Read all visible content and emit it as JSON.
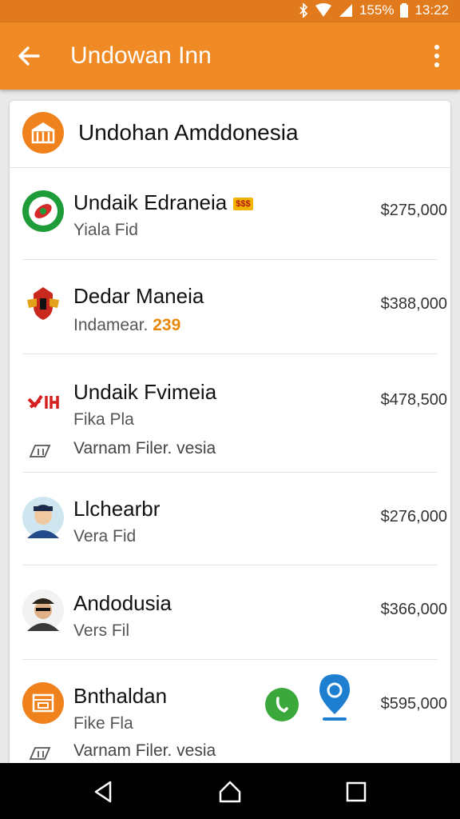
{
  "status_bar": {
    "battery": "155%",
    "time": "13:22",
    "icons": [
      "bluetooth-icon",
      "wifi-icon",
      "signal-icon",
      "battery-icon"
    ]
  },
  "app_bar": {
    "title": "Undowan Inn",
    "back_icon": "arrow-left-icon",
    "menu_icon": "more-vert-icon"
  },
  "card": {
    "title": "Undohan Amddonesia",
    "icon": "store-icon"
  },
  "rows": [
    {
      "name": "Undaik Edraneia",
      "subtitle": "Yiala Fid",
      "price": "$275,000",
      "badge": "$$$",
      "avatar": "green-logo-icon"
    },
    {
      "name": "Dedar Maneia",
      "subtitle": "Indamear.",
      "subtitle_highlight": "239",
      "price": "$388,000",
      "avatar": "crest-icon"
    },
    {
      "name": "Undaik Fvimeia",
      "subtitle": "Fika Pla",
      "extra": "Varnam Filer. vesia",
      "price": "$478,500",
      "avatar": "red-logo-icon",
      "extra_icon": "ticket-icon"
    },
    {
      "name": "Llchearbr",
      "subtitle": "Vera Fid",
      "price": "$276,000",
      "avatar": "person-avatar-icon"
    },
    {
      "name": "Andodusia",
      "subtitle": "Vers Fil",
      "price": "$366,000",
      "avatar": "person-avatar-icon"
    },
    {
      "name": "Bnthaldan",
      "subtitle": "Fike Fla",
      "extra": "Varnam Filer. vesia",
      "price": "$595,000",
      "avatar": "orange-store-icon",
      "extra_icon": "ticket-icon",
      "action_icons": [
        "phone-icon",
        "location-pin-icon"
      ]
    }
  ],
  "nav_bar": {
    "icons": [
      "back-triangle-icon",
      "home-icon",
      "recents-icon"
    ]
  },
  "colors": {
    "app_bar": "#f08a24",
    "status_bar": "#e07a1c",
    "accent": "#f0821e",
    "highlight": "#e8890c"
  }
}
